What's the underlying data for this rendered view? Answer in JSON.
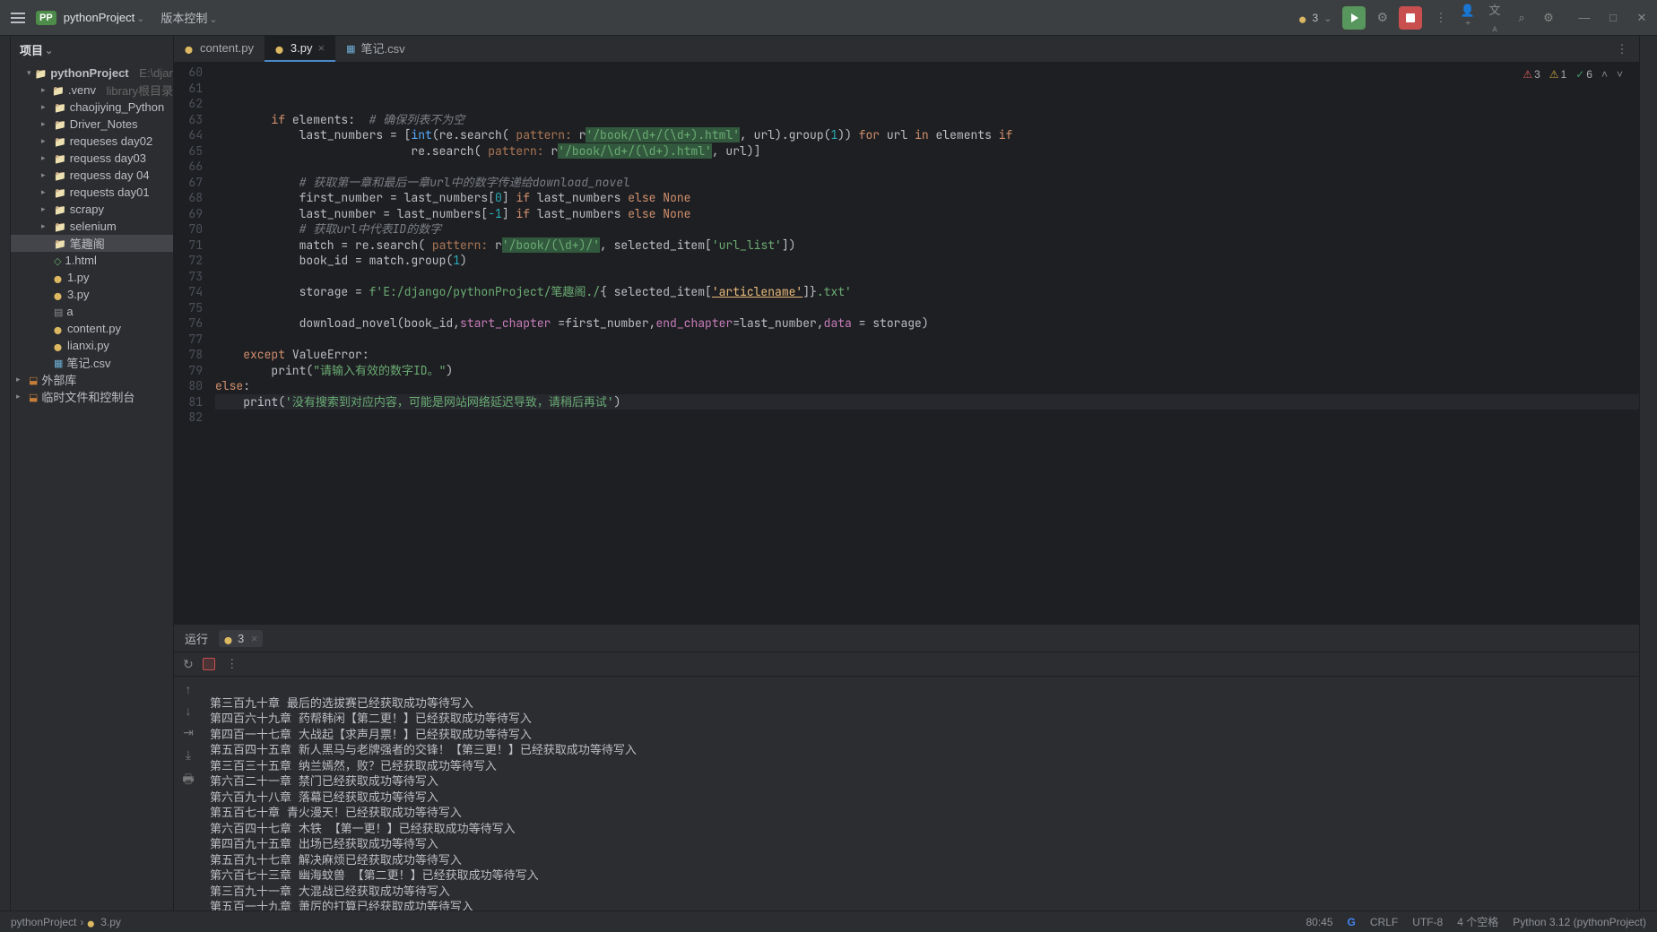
{
  "titlebar": {
    "project_badge": "PP",
    "project_name": "pythonProject",
    "vc_label": "版本控制",
    "python_ver": "3",
    "icons": {
      "collab": "👤⁺",
      "lang": "あ",
      "search": "🔍",
      "settings": "⚙",
      "min": "—",
      "max": "□",
      "close": "✕"
    }
  },
  "project": {
    "header": "项目",
    "root": "pythonProject",
    "root_path": "E:\\django\\py",
    "venv_name": ".venv",
    "venv_hint": "library根目录",
    "folders": [
      "chaojiying_Python",
      "Driver_Notes",
      "requeses day02",
      "requess day03",
      "requess day 04",
      "requests day01",
      "scrapy",
      "selenium",
      "笔趣阁"
    ],
    "files": {
      "html": "1.html",
      "py1": "1.py",
      "py3": "3.py",
      "txt": "a",
      "content": "content.py",
      "lianxi": "lianxi.py",
      "csv": "笔记.csv"
    },
    "extlib": "外部库",
    "scratch": "临时文件和控制台"
  },
  "tabs": {
    "t1": "content.py",
    "t2": "3.py",
    "t3": "笔记.csv"
  },
  "inspections": {
    "err": "3",
    "warn": "1",
    "ok": "6"
  },
  "code": {
    "ln": [
      "60",
      "61",
      "62",
      "63",
      "64",
      "65",
      "66",
      "67",
      "68",
      "69",
      "70",
      "71",
      "72",
      "73",
      "74",
      "75",
      "76",
      "77",
      "78",
      "79",
      "80",
      "81",
      "82"
    ],
    "l62_if": "if",
    "l62_elements": " elements:  ",
    "l62_c": "# 确保列表不为空",
    "l63_a": "            last_numbers = [",
    "l63_int": "int",
    "l63_b": "(re.search( ",
    "l63_ptn": "pattern:",
    "l63_r": " r",
    "l63_rx": "'/book/\\d+/(\\d+).html'",
    "l63_c1": ", url).group(",
    "l63_1": "1",
    "l63_c2": ")) ",
    "l63_for": "for",
    "l63_url": " url ",
    "l63_in": "in",
    "l63_el": " elements ",
    "l63_if": "if",
    "l64_a": "                            re.search( ",
    "l64_b": ", url)]",
    "l66_c": "# 获取第一章和最后一章url中的数字传递给download_novel",
    "l67_a": "            first_number = last_numbers[",
    "l67_0": "0",
    "l67_b": "] ",
    "l67_if": "if",
    "l67_ln": " last_numbers ",
    "l67_else": "else ",
    "l67_none": "None",
    "l68_a": "            last_number = last_numbers[",
    "l68_m1": "-1",
    "l69_c": "# 获取url中代表ID的数字",
    "l70_a": "            match = re.search( ",
    "l70_rx": "'/book/(\\d+)/'",
    "l70_b": ", selected_item[",
    "l70_key": "'url_list'",
    "l70_c2": "])",
    "l71_a": "            book_id = match.group(",
    "l73_a": "            storage = ",
    "l73_f": "f'E:/django/pythonProject/笔趣阁./",
    "l73_b": "{ selected_item[",
    "l73_art": "'articlename'",
    "l73_c2": "]}",
    "l73_txt": ".txt'",
    "l75_a": "            download_novel(book_id,",
    "l75_sc": "start_chapter",
    "l75_b": " =first_number,",
    "l75_ec": "end_chapter",
    "l75_c2": "=last_number,",
    "l75_d": "data",
    "l75_e": " = storage)",
    "l77_ex": "    except ",
    "l77_ve": "ValueError",
    "l77_col": ":",
    "l78_pr": "        print(",
    "l78_s": "\"请输入有效的数字ID。\"",
    "l78_cp": ")",
    "l79_else": "else",
    "l79_col": ":",
    "l80_pr": "    print(",
    "l80_s": "'没有搜索到对应内容，可能是网站网络延迟导致，请稍后再试'",
    "l80_cp": ")"
  },
  "run": {
    "label": "运行",
    "config": "3",
    "output": [
      "第三百九十章 最后的选拔赛已经获取成功等待写入",
      "第四百六十九章 药帮韩闲【第二更！】已经获取成功等待写入",
      "第四百一十七章 大战起【求声月票！】已经获取成功等待写入",
      "第五百四十五章 新人黑马与老牌强者的交锋！【第三更！】已经获取成功等待写入",
      "第三百三十五章 纳兰嫣然，败？已经获取成功等待写入",
      "第六百二十一章 禁门已经获取成功等待写入",
      "第六百九十八章 落幕已经获取成功等待写入",
      "第五百七十章 青火漫天！已经获取成功等待写入",
      "第六百四十七章 木铁 【第一更！】已经获取成功等待写入",
      "第四百九十五章 出场已经获取成功等待写入",
      "第五百九十七章 解决麻烦已经获取成功等待写入",
      "第六百七十三章 幽海蚊兽 【第二更！】已经获取成功等待写入",
      "第三百九十一章 大混战已经获取成功等待写入",
      "第五百一十九章 萧厉的打算已经获取成功等待写入"
    ]
  },
  "status": {
    "crumb1": "pythonProject",
    "crumb2": "3.py",
    "pos": "80:45",
    "eol": "CRLF",
    "enc": "UTF-8",
    "indent": "4 个空格",
    "interp": "Python 3.12 (pythonProject)"
  }
}
